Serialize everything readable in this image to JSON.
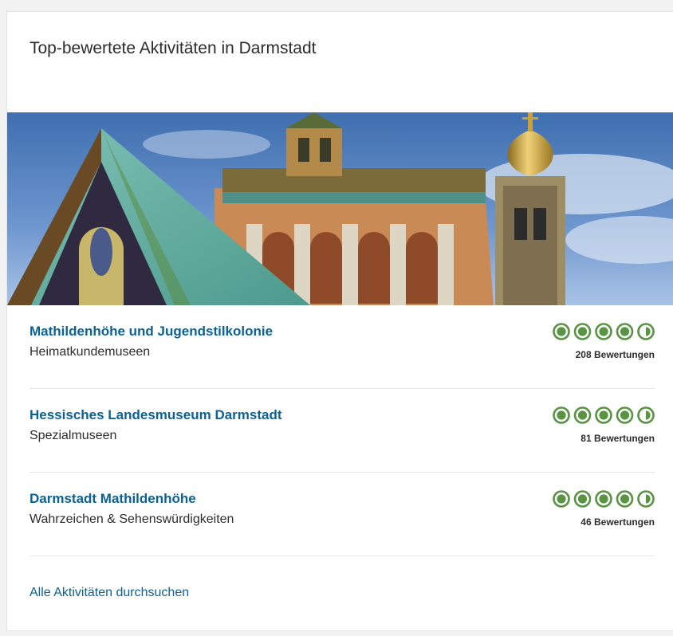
{
  "section": {
    "title": "Top-bewertete Aktivitäten in Darmstadt",
    "browse_link": "Alle Aktivitäten durchsuchen"
  },
  "colors": {
    "link": "#0a6296",
    "bubble": "#589442"
  },
  "activities": [
    {
      "name": "Mathildenhöhe und Jugendstilkolonie",
      "category": "Heimatkundemuseen",
      "rating": 4.5,
      "reviews": "208 Bewertungen"
    },
    {
      "name": "Hessisches Landesmuseum Darmstadt",
      "category": "Spezialmuseen",
      "rating": 4.5,
      "reviews": "81 Bewertungen"
    },
    {
      "name": "Darmstadt Mathildenhöhe",
      "category": "Wahrzeichen & Sehenswürdigkeiten",
      "rating": 4.5,
      "reviews": "46 Bewertungen"
    }
  ]
}
